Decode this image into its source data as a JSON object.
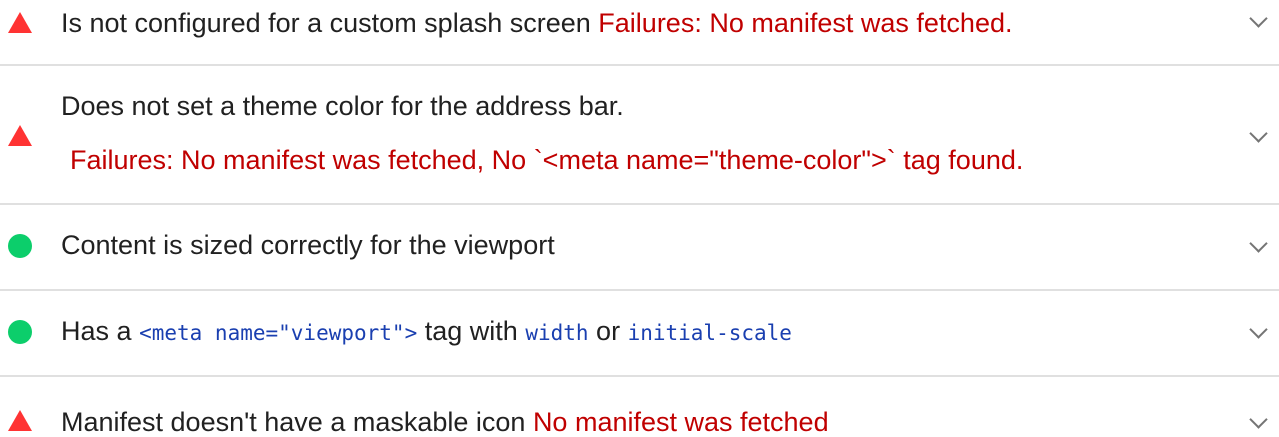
{
  "colors": {
    "fail": "#ff3333",
    "pass": "#0cce6b",
    "failure_text": "#c00000",
    "code_text": "#1a3fb0",
    "divider": "#e0e0e0"
  },
  "audits": [
    {
      "status": "fail",
      "icon": "triangle-warning-icon",
      "title": "Is not configured for a custom splash screen",
      "failure": "Failures: No manifest was fetched."
    },
    {
      "status": "fail",
      "icon": "triangle-warning-icon",
      "title": "Does not set a theme color for the address bar.",
      "failure": "Failures: No manifest was fetched, No `<meta name=\"theme-color\">` tag found."
    },
    {
      "status": "pass",
      "icon": "circle-pass-icon",
      "title": "Content is sized correctly for the viewport"
    },
    {
      "status": "pass",
      "icon": "circle-pass-icon",
      "title_prefix": "Has a",
      "code_meta": "<meta name=\"viewport\">",
      "title_mid": "tag with",
      "code_width": "width",
      "title_or": "or",
      "code_scale": "initial-scale"
    },
    {
      "status": "fail",
      "icon": "triangle-warning-icon",
      "title": "Manifest doesn't have a maskable icon",
      "failure": "No manifest was fetched"
    }
  ]
}
